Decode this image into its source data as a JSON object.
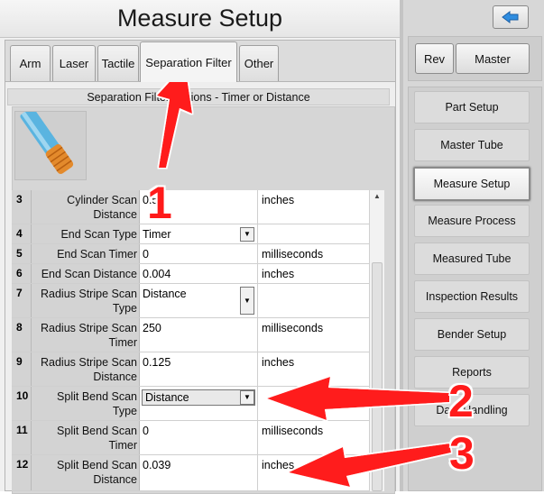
{
  "title": "Measure Setup",
  "tabs": [
    {
      "label": "Arm"
    },
    {
      "label": "Laser"
    },
    {
      "label": "Tactile"
    },
    {
      "label": "Separation Filter",
      "active": true
    },
    {
      "label": "Other"
    }
  ],
  "section_header": "Separation Filter Options - Timer or Distance",
  "rows": [
    {
      "num": "3",
      "label": "Cylinder Scan Distance",
      "value": "0.5",
      "unit": "inches",
      "control": "text"
    },
    {
      "num": "4",
      "label": "End Scan Type",
      "value": "Timer",
      "unit": "",
      "control": "dropdown"
    },
    {
      "num": "5",
      "label": "End Scan Timer",
      "value": "0",
      "unit": "milliseconds",
      "control": "text"
    },
    {
      "num": "6",
      "label": "End Scan Distance",
      "value": "0.004",
      "unit": "inches",
      "control": "text"
    },
    {
      "num": "7",
      "label": "Radius Stripe Scan Type",
      "value": "Distance",
      "unit": "",
      "control": "dropdown"
    },
    {
      "num": "8",
      "label": "Radius Stripe Scan Timer",
      "value": "250",
      "unit": "milliseconds",
      "control": "text"
    },
    {
      "num": "9",
      "label": "Radius Stripe Scan Distance",
      "value": "0.125",
      "unit": "inches",
      "control": "text"
    },
    {
      "num": "10",
      "label": "Split Bend Scan Type",
      "value": "Distance",
      "unit": "",
      "control": "dropdown-open"
    },
    {
      "num": "11",
      "label": "Split Bend Scan Timer",
      "value": "0",
      "unit": "milliseconds",
      "control": "text"
    },
    {
      "num": "12",
      "label": "Split Bend Scan Distance",
      "value": "0.039",
      "unit": "inches",
      "control": "text"
    }
  ],
  "right_panel": {
    "rev_label": "Rev",
    "master_label": "Master",
    "nav": [
      {
        "label": "Part Setup"
      },
      {
        "label": "Master Tube"
      },
      {
        "label": "Measure Setup",
        "active": true
      },
      {
        "label": "Measure Process"
      },
      {
        "label": "Measured Tube"
      },
      {
        "label": "Inspection Results"
      },
      {
        "label": "Bender Setup"
      },
      {
        "label": "Reports"
      },
      {
        "label": "Data Handling"
      }
    ]
  },
  "callouts": [
    "1",
    "2",
    "3"
  ],
  "colors": {
    "callout": "#ff1a1a",
    "back_arrow": "#2f8de0"
  },
  "icons": {
    "back": "arrow-left-icon",
    "dropdown": "chevron-down-icon"
  }
}
